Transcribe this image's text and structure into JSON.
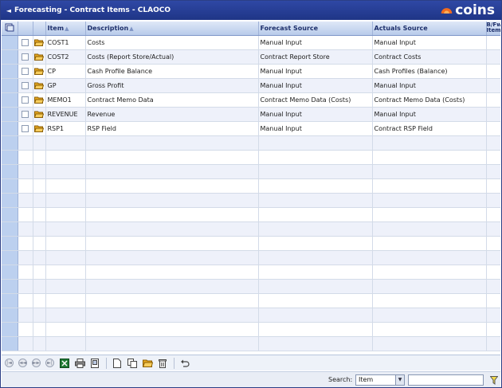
{
  "title": "Forecasting - Contract Items - CLAOCO",
  "back_glyph": "◄",
  "logo_text": "coins",
  "columns": {
    "item": "Item",
    "description": "Description",
    "forecast_source": "Forecast Source",
    "actuals_source": "Actuals Source",
    "bfwd_item": "B/Fwd Item"
  },
  "rows": [
    {
      "item": "COST1",
      "description": "Costs",
      "forecast_source": "Manual Input",
      "actuals_source": "Manual Input"
    },
    {
      "item": "COST2",
      "description": "Costs (Report Store/Actual)",
      "forecast_source": "Contract Report Store",
      "actuals_source": "Contract Costs"
    },
    {
      "item": "CP",
      "description": "Cash Profile Balance",
      "forecast_source": "Manual Input",
      "actuals_source": "Cash Profiles (Balance)"
    },
    {
      "item": "GP",
      "description": "Gross Profit",
      "forecast_source": "Manual Input",
      "actuals_source": "Manual Input"
    },
    {
      "item": "MEMO1",
      "description": "Contract Memo Data",
      "forecast_source": "Contract Memo Data (Costs)",
      "actuals_source": "Contract Memo Data (Costs)"
    },
    {
      "item": "REVENUE",
      "description": "Revenue",
      "forecast_source": "Manual Input",
      "actuals_source": "Manual Input"
    },
    {
      "item": "RSP1",
      "description": "RSP Field",
      "forecast_source": "Manual Input",
      "actuals_source": "Contract RSP Field"
    }
  ],
  "toolbar": {
    "icons": [
      "first-page-icon",
      "previous-page-icon",
      "next-page-icon",
      "last-page-icon",
      "excel-export-icon",
      "print-icon",
      "print-preview-icon",
      "new-document-icon",
      "copy-icon",
      "open-folder-icon",
      "delete-icon",
      "undo-icon"
    ]
  },
  "search": {
    "label": "Search:",
    "field": "Item",
    "value": ""
  },
  "colors": {
    "titlebar": "#1f3586",
    "header": "#b8cbea",
    "selector_column": "#bcd0ef",
    "alt_row": "#eef1fa",
    "folder": "#e8a820",
    "logo_orange": "#f26b1d"
  }
}
